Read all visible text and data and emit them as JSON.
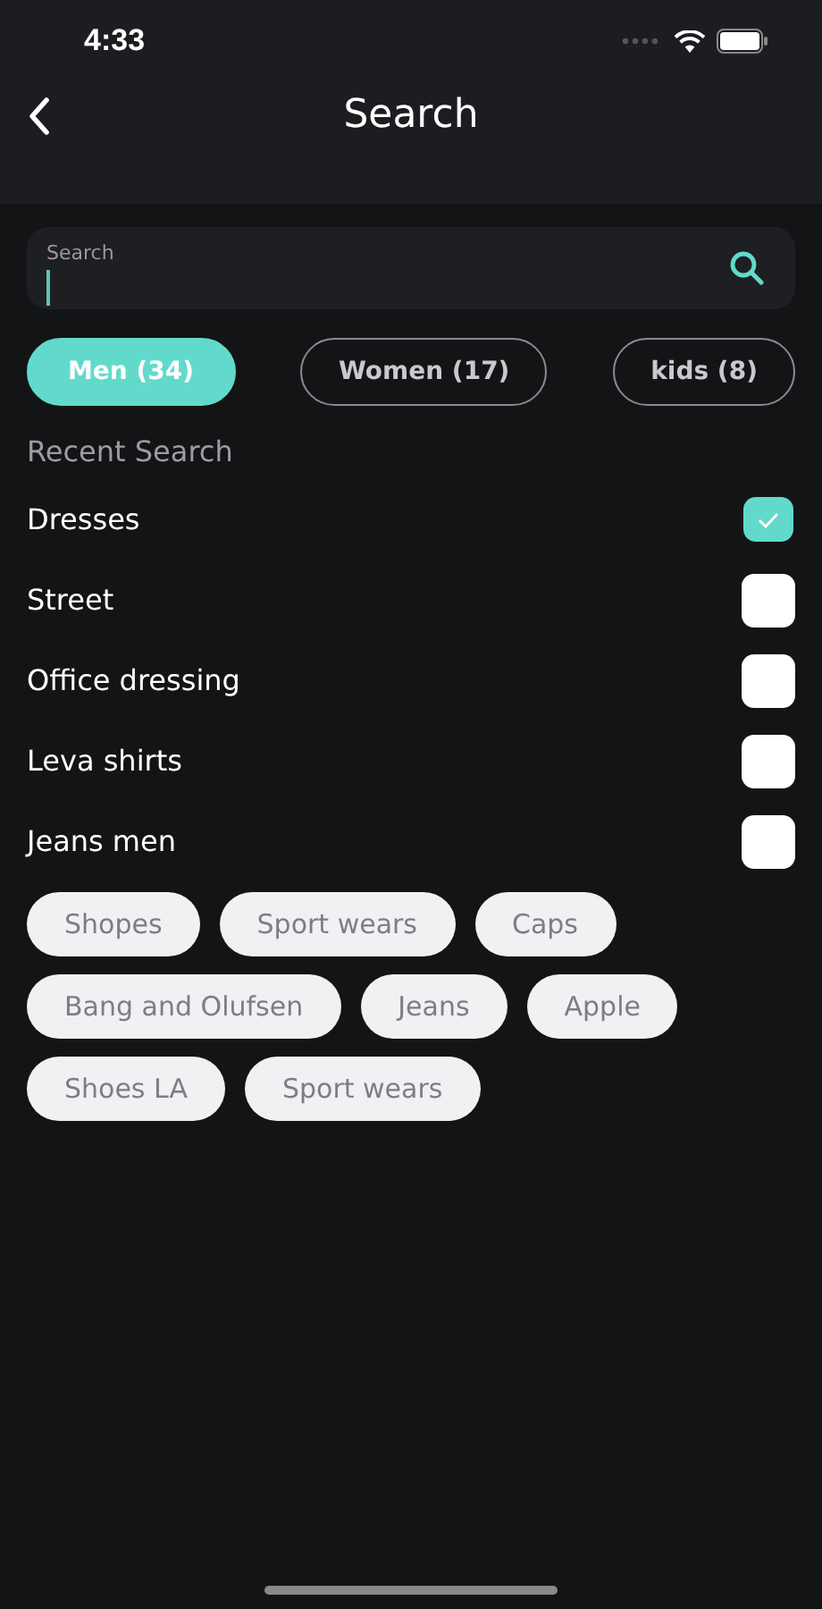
{
  "status_bar": {
    "time": "4:33"
  },
  "header": {
    "title": "Search"
  },
  "search": {
    "placeholder": "Search"
  },
  "filters": [
    {
      "label": "Men (34)",
      "selected": true
    },
    {
      "label": "Women (17)",
      "selected": false
    },
    {
      "label": "kids (8)",
      "selected": false
    }
  ],
  "recent_title": "Recent Search",
  "recent": [
    {
      "label": "Dresses",
      "checked": true
    },
    {
      "label": "Street",
      "checked": false
    },
    {
      "label": "Office dressing",
      "checked": false
    },
    {
      "label": "Leva shirts",
      "checked": false
    },
    {
      "label": "Jeans men",
      "checked": false
    }
  ],
  "tags": [
    "Shopes",
    "Sport wears",
    "Caps",
    "Bang and Olufsen",
    "Jeans",
    "Apple",
    "Shoes LA",
    "Sport wears"
  ]
}
